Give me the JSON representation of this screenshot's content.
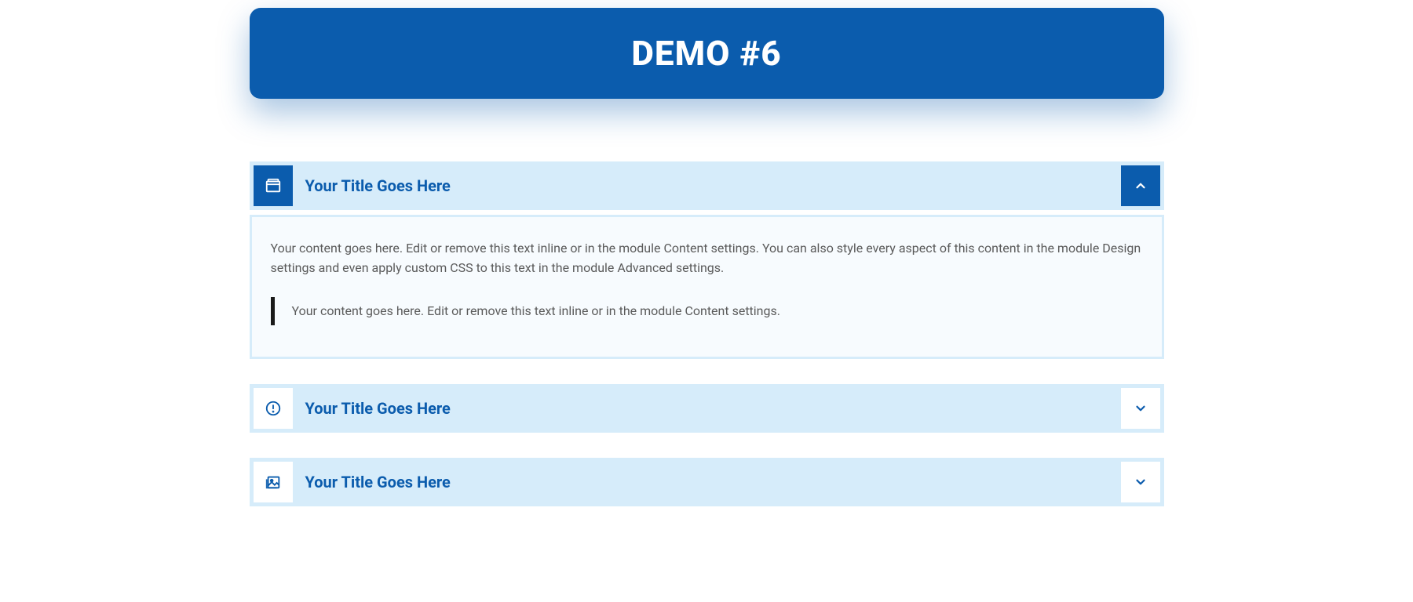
{
  "header": {
    "title": "DEMO #6"
  },
  "accordion": [
    {
      "icon": "window-icon",
      "title": "Your Title Goes Here",
      "expanded": true,
      "content_paragraph": "Your content goes here. Edit or remove this text inline or in the module Content settings. You can also style every aspect of this content in the module Design settings and even apply custom CSS to this text in the module Advanced settings.",
      "content_quote": "Your content goes here. Edit or remove this text inline or in the module Content settings."
    },
    {
      "icon": "alert-circle-icon",
      "title": "Your Title Goes Here",
      "expanded": false
    },
    {
      "icon": "image-icon",
      "title": "Your Title Goes Here",
      "expanded": false
    }
  ]
}
